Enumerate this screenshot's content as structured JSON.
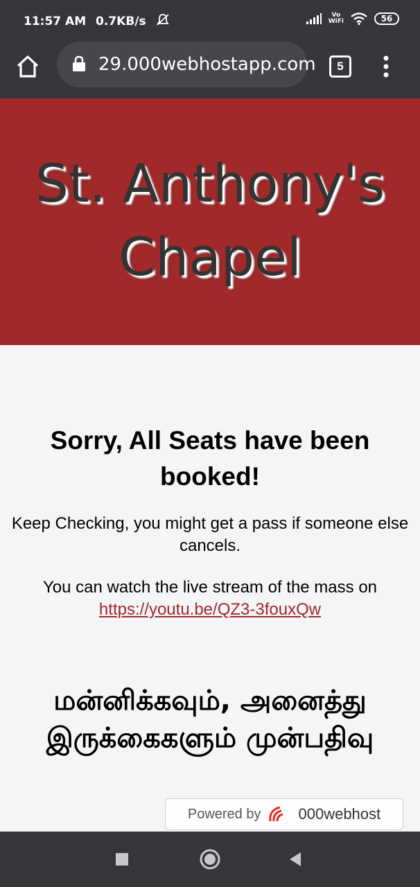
{
  "status_bar": {
    "time": "11:57 AM",
    "speed": "0.7KB/s",
    "volte_top": "Vo",
    "volte_bottom": "WiFi",
    "battery": "56"
  },
  "browser": {
    "url": "29.000webhostapp.com",
    "tab_count": "5"
  },
  "header": {
    "title_line1": "St. Anthony's",
    "title_line2": "Chapel",
    "bg_color": "#a1292a"
  },
  "content": {
    "heading": "Sorry, All Seats have been booked!",
    "paragraph1": "Keep Checking, you might get a pass if someone else cancels.",
    "paragraph2_prefix": "You can watch the live stream of the mass on",
    "stream_url": "https://youtu.be/QZ3-3fouxQw",
    "tamil_heading": "மன்னிக்கவும், அனைத்து இருக்கைகளும் முன்பதிவு"
  },
  "badge": {
    "powered_by": "Powered by",
    "brand": "000webhost"
  },
  "icons": {
    "home": "home-icon",
    "lock": "lock-icon",
    "menu": "more-vert-icon",
    "nav_recent": "square-icon",
    "nav_home": "circle-icon",
    "nav_back": "triangle-back-icon"
  }
}
